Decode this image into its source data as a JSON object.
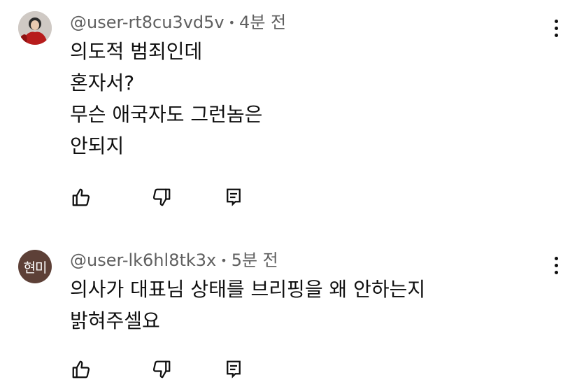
{
  "comments": [
    {
      "author": "@user-rt8cu3vd5v",
      "separator": "•",
      "time": "4분 전",
      "avatar_type": "photo",
      "avatar_initials": "",
      "lines": [
        "의도적 범죄인데",
        "혼자서?",
        "무슨 애국자도 그런놈은",
        "안되지"
      ],
      "icons": {
        "like": "thumbs-up-icon",
        "dislike": "thumbs-down-icon",
        "reply": "reply-icon",
        "menu": "more-vertical-icon"
      }
    },
    {
      "author": "@user-lk6hl8tk3x",
      "separator": "•",
      "time": "5분 전",
      "avatar_type": "initials",
      "avatar_initials": "현미",
      "lines": [
        "의사가 대표님 상태를 브리핑을 왜 안하는지",
        "밝혀주셀요"
      ],
      "icons": {
        "like": "thumbs-up-icon",
        "dislike": "thumbs-down-icon",
        "reply": "reply-icon",
        "menu": "more-vertical-icon"
      }
    }
  ],
  "colors": {
    "avatar_initials_bg": "#5d4037",
    "meta_text": "#606060",
    "body_text": "#0f0f0f"
  }
}
